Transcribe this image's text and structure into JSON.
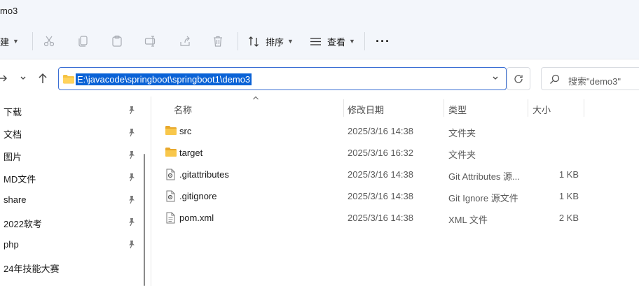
{
  "window": {
    "title": "mo3"
  },
  "toolbar": {
    "new_label": "建",
    "sort_label": "排序",
    "view_label": "查看",
    "more_label": "···"
  },
  "address": {
    "path": "E:\\javacode\\springboot\\springboot1\\demo3"
  },
  "search": {
    "placeholder": "搜索\"demo3\""
  },
  "sidebar": {
    "items": [
      {
        "label": "下载",
        "pinned": true
      },
      {
        "label": "文档",
        "pinned": true
      },
      {
        "label": "图片",
        "pinned": true
      },
      {
        "label": "MD文件",
        "pinned": true
      },
      {
        "label": "share",
        "pinned": true
      },
      {
        "label": "2022软考",
        "pinned": true
      },
      {
        "label": "php",
        "pinned": true
      },
      {
        "label": "24年技能大赛",
        "pinned": false
      }
    ]
  },
  "columns": {
    "name": "名称",
    "date": "修改日期",
    "type": "类型",
    "size": "大小"
  },
  "files": [
    {
      "name": "src",
      "date": "2025/3/16 14:38",
      "type": "文件夹",
      "size": "",
      "icon": "folder-icon"
    },
    {
      "name": "target",
      "date": "2025/3/16 16:32",
      "type": "文件夹",
      "size": "",
      "icon": "folder-icon"
    },
    {
      "name": ".gitattributes",
      "date": "2025/3/16 14:38",
      "type": "Git Attributes 源...",
      "size": "1 KB",
      "icon": "config-file-icon"
    },
    {
      "name": ".gitignore",
      "date": "2025/3/16 14:38",
      "type": "Git Ignore 源文件",
      "size": "1 KB",
      "icon": "config-file-icon"
    },
    {
      "name": "pom.xml",
      "date": "2025/3/16 14:38",
      "type": "XML 文件",
      "size": "2 KB",
      "icon": "document-icon"
    }
  ],
  "colors": {
    "accent": "#0a62d6",
    "folder": "#f5c242",
    "chrome_bg": "#f3f6fb"
  }
}
